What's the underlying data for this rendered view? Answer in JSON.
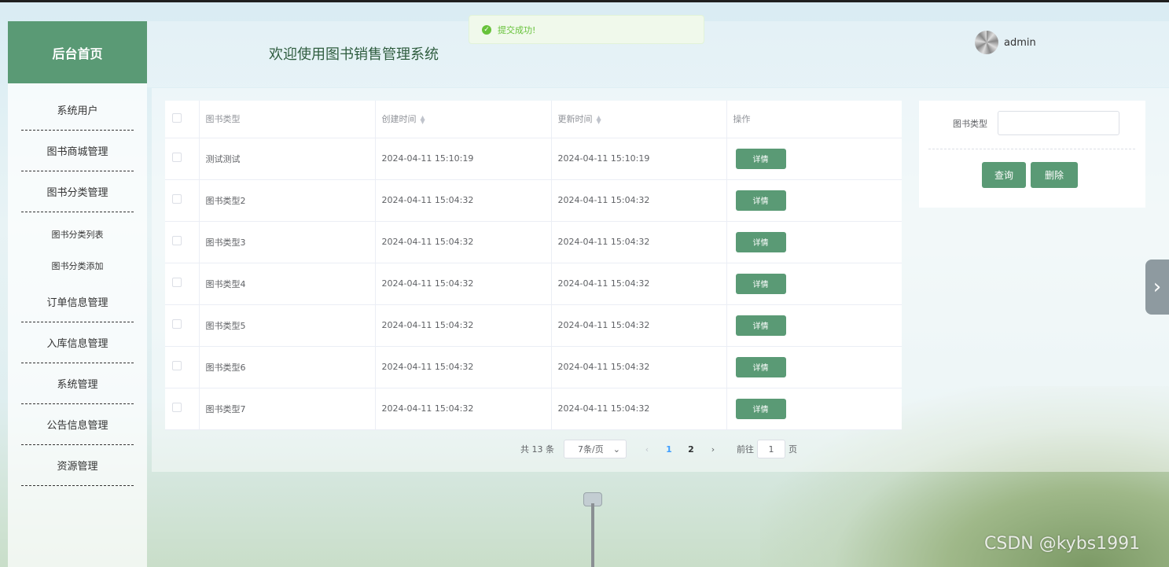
{
  "sidebar": {
    "title": "后台首页",
    "items": [
      {
        "label": "系统用户"
      },
      {
        "label": "图书商城管理"
      },
      {
        "label": "图书分类管理"
      },
      {
        "label": "图书分类列表",
        "sub": true
      },
      {
        "label": "图书分类添加",
        "sub": true
      },
      {
        "label": "订单信息管理"
      },
      {
        "label": "入库信息管理"
      },
      {
        "label": "系统管理"
      },
      {
        "label": "公告信息管理"
      },
      {
        "label": "资源管理"
      }
    ]
  },
  "header": {
    "welcome": "欢迎使用图书销售管理系统",
    "username": "admin"
  },
  "toast": {
    "message": "提交成功!",
    "icon": "check-circle-icon",
    "color": "#67c23a"
  },
  "table": {
    "headers": [
      "图书类型",
      "创建时间",
      "更新时间",
      "操作"
    ],
    "action_label": "详情",
    "rows": [
      {
        "type": "测试测试",
        "created": "2024-04-11 15:10:19",
        "updated": "2024-04-11 15:10:19"
      },
      {
        "type": "图书类型2",
        "created": "2024-04-11 15:04:32",
        "updated": "2024-04-11 15:04:32"
      },
      {
        "type": "图书类型3",
        "created": "2024-04-11 15:04:32",
        "updated": "2024-04-11 15:04:32"
      },
      {
        "type": "图书类型4",
        "created": "2024-04-11 15:04:32",
        "updated": "2024-04-11 15:04:32"
      },
      {
        "type": "图书类型5",
        "created": "2024-04-11 15:04:32",
        "updated": "2024-04-11 15:04:32"
      },
      {
        "type": "图书类型6",
        "created": "2024-04-11 15:04:32",
        "updated": "2024-04-11 15:04:32"
      },
      {
        "type": "图书类型7",
        "created": "2024-04-11 15:04:32",
        "updated": "2024-04-11 15:04:32"
      }
    ]
  },
  "pagination": {
    "total": "共 13 条",
    "page_size": "7条/页",
    "pages": [
      "1",
      "2"
    ],
    "current": "1",
    "goto_prefix": "前往",
    "goto_value": "1",
    "goto_suffix": "页"
  },
  "search": {
    "label": "图书类型",
    "value": "",
    "query_label": "查询",
    "delete_label": "删除"
  },
  "watermark": "CSDN @kybs1991",
  "theme": {
    "primary": "#5a9a75",
    "link": "#409eff"
  }
}
